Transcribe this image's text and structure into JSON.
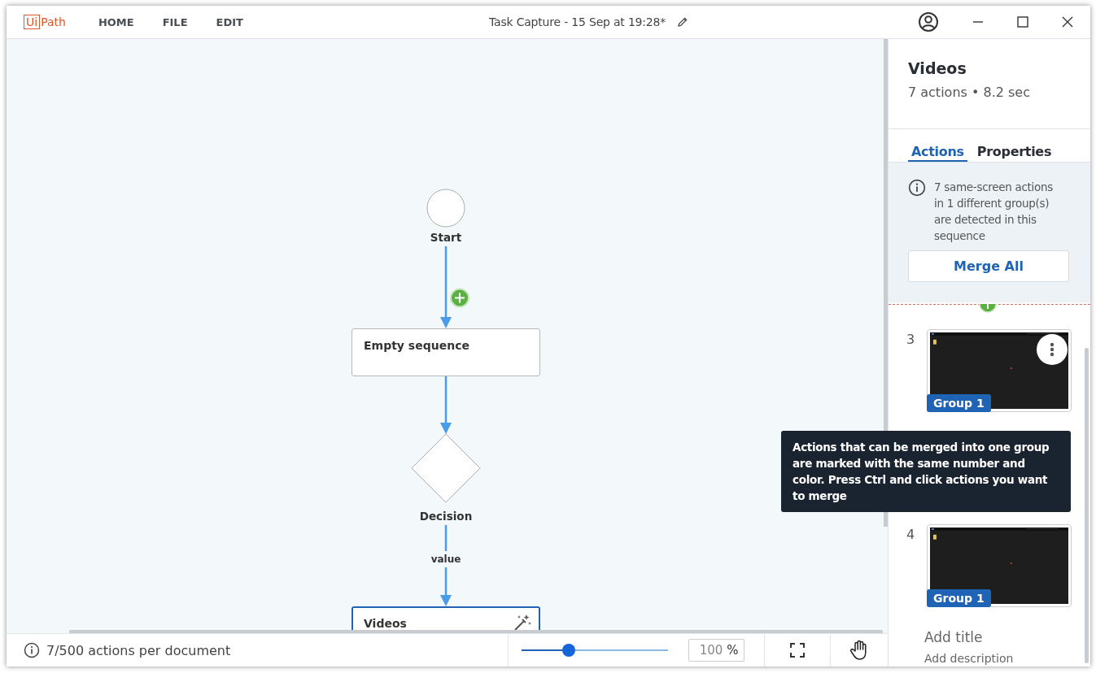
{
  "logo": {
    "boxed": "Ui",
    "rest": "Path"
  },
  "menu": [
    {
      "label": "HOME"
    },
    {
      "label": "FILE"
    },
    {
      "label": "EDIT"
    }
  ],
  "window": {
    "title": "Task Capture - 15 Sep at 19:28*"
  },
  "canvas": {
    "nodes": [
      {
        "kind": "start",
        "label": "Start"
      },
      {
        "kind": "sequence",
        "label": "Empty sequence",
        "selected": false,
        "magic_icon": false
      },
      {
        "kind": "decision",
        "label": "Decision",
        "branch_label": "value"
      },
      {
        "kind": "sequence",
        "label": "Videos",
        "selected": true,
        "magic_icon": true
      }
    ]
  },
  "status": {
    "text": "7/500 actions per document",
    "zoom_slider": {
      "level": 0.32
    },
    "zoom_value": "100",
    "zoom_unit": "%"
  },
  "panel": {
    "title": "Videos",
    "summary": "7 actions • 8.2 sec",
    "tabs": [
      {
        "label": "Actions",
        "selected": true
      },
      {
        "label": "Properties",
        "selected": false
      }
    ],
    "notice": "7 same-screen actions in 1 different group(s) are detected in this sequence",
    "merge_button": "Merge All",
    "actions": [
      {
        "number": "3",
        "group": "Group 1",
        "menu_shown": true
      },
      {
        "number": "4",
        "group": "Group 1",
        "menu_shown": false
      }
    ],
    "title_placeholder": "Add title",
    "description_placeholder": "Add description"
  },
  "tooltip": "Actions that can be merged into one group are marked with the same number and color. Press Ctrl and click actions you want to merge"
}
